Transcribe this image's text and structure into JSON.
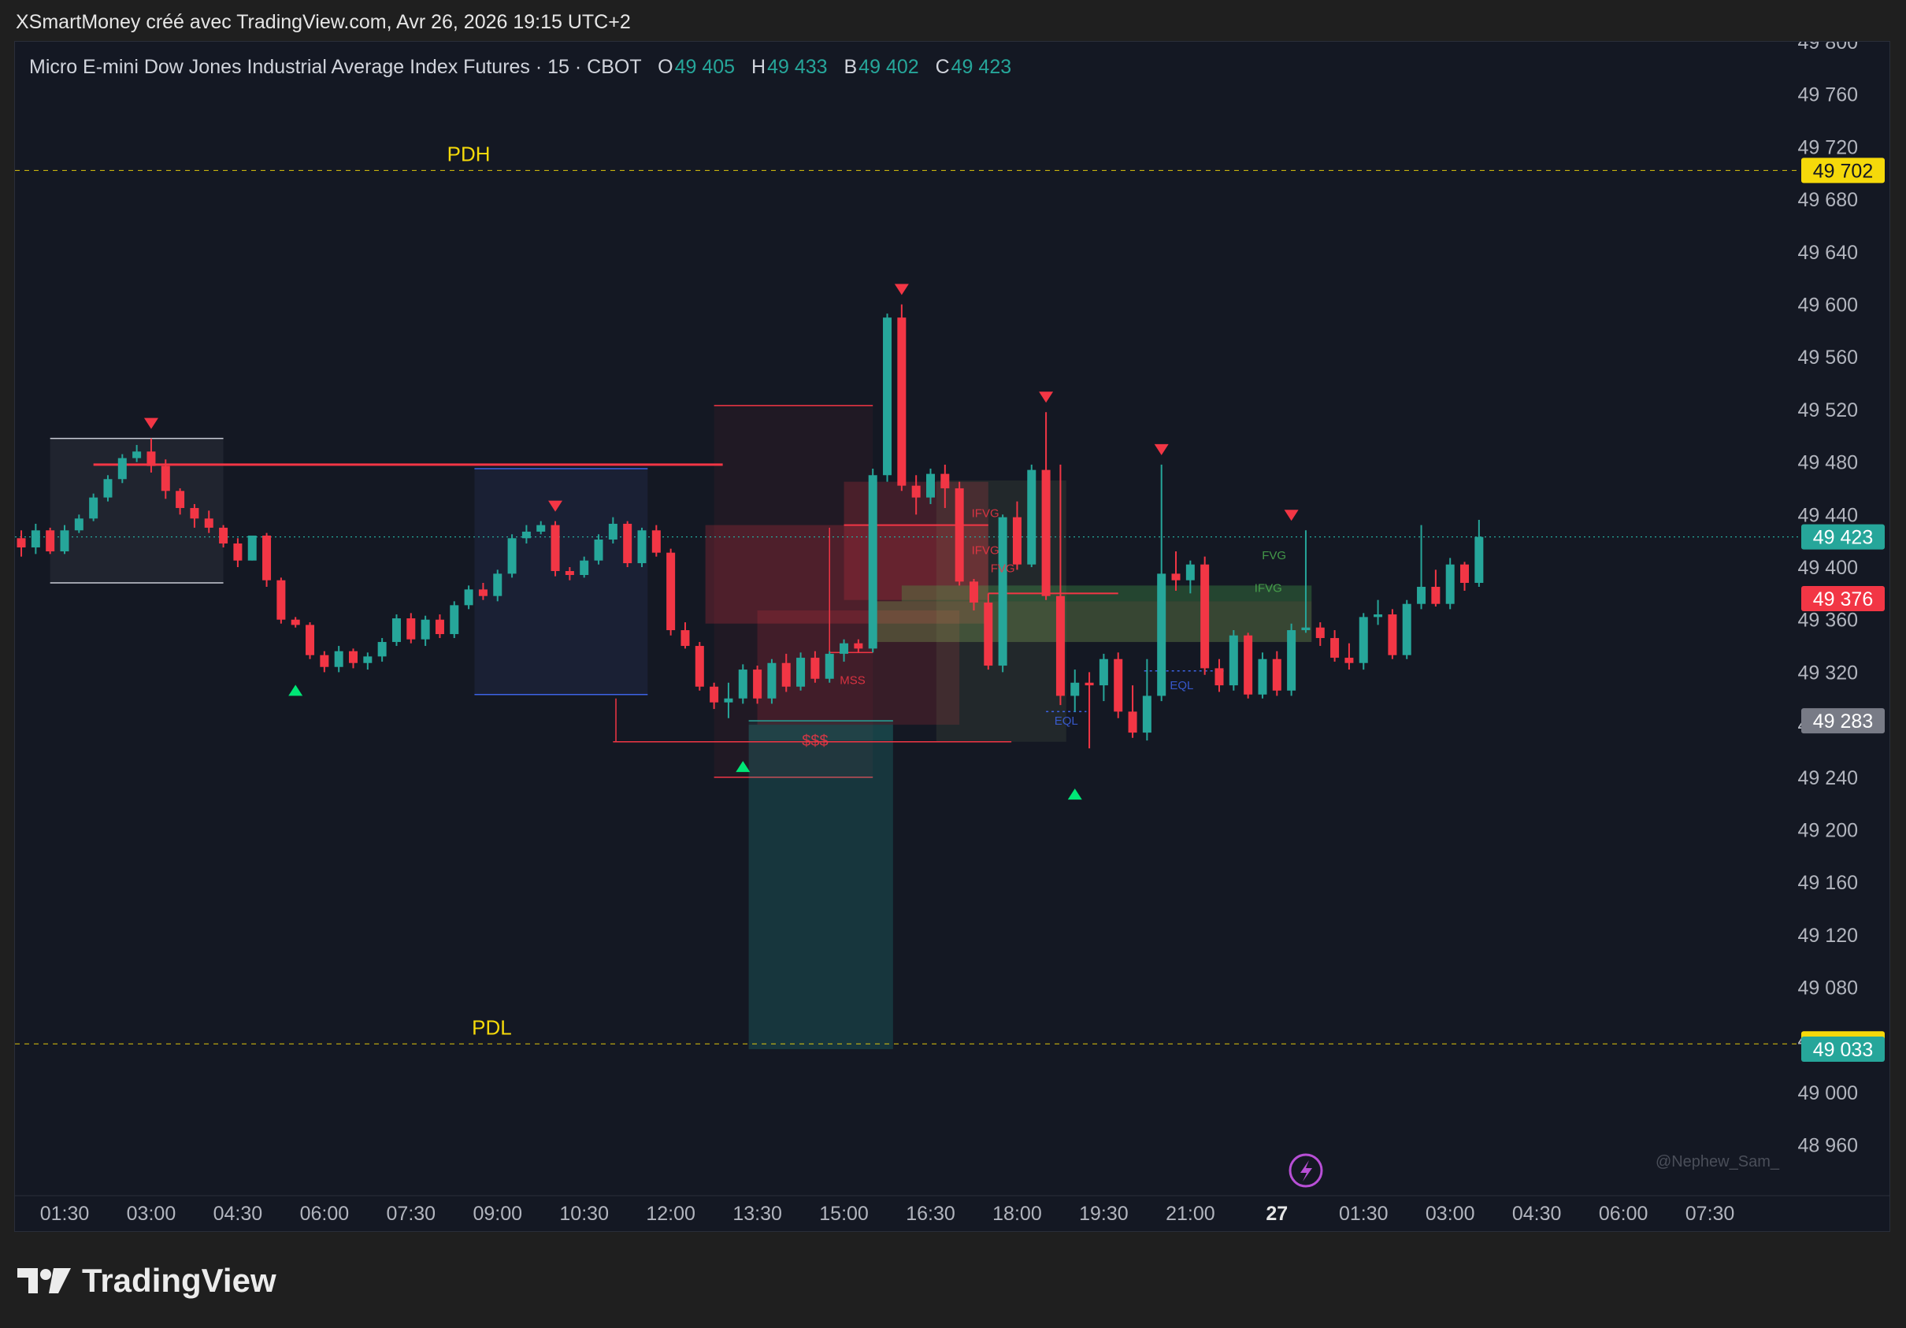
{
  "header": {
    "attribution": "XSmartMoney créé avec TradingView.com, Avr 26, 2026 19:15 UTC+2"
  },
  "legend": {
    "symbol": "Micro E-mini Dow Jones Industrial Average Index Futures · 15 · CBOT",
    "o_label": "O",
    "o_value": "49 405",
    "h_label": "H",
    "h_value": "49 433",
    "b_label": "B",
    "b_value": "49 402",
    "c_label": "C",
    "c_value": "49 423"
  },
  "brand": {
    "name": "TradingView"
  },
  "watermark": "@Nephew_Sam_",
  "colors": {
    "up": "#26a69a",
    "down": "#f23645",
    "pdh_pdl": "#f5d90a",
    "background": "#141823",
    "axis_text": "#b2b5be"
  },
  "chart_data": {
    "type": "candlestick",
    "y_range": [
      48940,
      49810
    ],
    "y_ticks": [
      "49 800",
      "49 760",
      "49 720",
      "49 680",
      "49 640",
      "49 600",
      "49 560",
      "49 520",
      "49 480",
      "49 440",
      "49 400",
      "49 360",
      "49 320",
      "49 280",
      "49 240",
      "49 200",
      "49 160",
      "49 120",
      "49 080",
      "49 040",
      "49 000",
      "48 960"
    ],
    "x_labels": [
      "01:30",
      "03:00",
      "04:30",
      "06:00",
      "07:30",
      "09:00",
      "10:30",
      "12:00",
      "13:30",
      "15:00",
      "16:30",
      "18:00",
      "19:30",
      "21:00",
      "27",
      "01:30",
      "03:00",
      "04:30",
      "06:00",
      "07:30"
    ],
    "price_labels": [
      {
        "value": 49702,
        "text": "49 702",
        "color": "#f5d90a",
        "text_color": "#131722"
      },
      {
        "value": 49423,
        "text": "49 423",
        "color": "#26a69a",
        "text_color": "#ffffff"
      },
      {
        "value": 49376,
        "text": "49 376",
        "color": "#f23645",
        "text_color": "#ffffff"
      },
      {
        "value": 49283,
        "text": "49 283",
        "color": "#787b86",
        "text_color": "#ffffff"
      },
      {
        "value": 49037,
        "text": "49 037",
        "color": "#f5d90a",
        "text_color": "#131722"
      },
      {
        "value": 49033,
        "text": "49 033",
        "color": "#26a69a",
        "text_color": "#ffffff"
      }
    ],
    "levels": [
      {
        "name": "PDH",
        "value": 49702,
        "label_time": 8.5
      },
      {
        "name": "PDL",
        "value": 49037,
        "label_time": 8.9
      }
    ],
    "current_price": 49423,
    "candles_start_time": 0.25,
    "candle_interval_hours": 0.25,
    "candles": [
      [
        49425,
        49430,
        49420,
        49412
      ],
      [
        49412,
        49425,
        49410,
        49422
      ],
      [
        49422,
        49428,
        49408,
        49415
      ],
      [
        49415,
        49433,
        49410,
        49428
      ],
      [
        49428,
        49430,
        49410,
        49412
      ],
      [
        49412,
        49432,
        49410,
        49428
      ],
      [
        49428,
        49440,
        49426,
        49437
      ],
      [
        49437,
        49456,
        49435,
        49453
      ],
      [
        49453,
        49470,
        49450,
        49467
      ],
      [
        49467,
        49486,
        49464,
        49483
      ],
      [
        49483,
        49493,
        49480,
        49488
      ],
      [
        49488,
        49498,
        49472,
        49477
      ],
      [
        49477,
        49482,
        49452,
        49458
      ],
      [
        49458,
        49460,
        49440,
        49445
      ],
      [
        49445,
        49448,
        49430,
        49437
      ],
      [
        49437,
        49443,
        49426,
        49430
      ],
      [
        49430,
        49432,
        49415,
        49418
      ],
      [
        49418,
        49422,
        49400,
        49405
      ],
      [
        49405,
        49408,
        49405,
        49424
      ],
      [
        49424,
        49426,
        49385,
        49390
      ],
      [
        49390,
        49392,
        49357,
        49360
      ],
      [
        49360,
        49362,
        49354,
        49356
      ],
      [
        49356,
        49358,
        49330,
        49333
      ],
      [
        49333,
        49336,
        49320,
        49324
      ],
      [
        49324,
        49340,
        49320,
        49336
      ],
      [
        49336,
        49338,
        49323,
        49327
      ],
      [
        49327,
        49335,
        49322,
        49332
      ],
      [
        49332,
        49346,
        49328,
        49343
      ],
      [
        49343,
        49364,
        49340,
        49361
      ],
      [
        49361,
        49365,
        49342,
        49345
      ],
      [
        49345,
        49363,
        49340,
        49360
      ],
      [
        49360,
        49364,
        49346,
        49349
      ],
      [
        49349,
        49374,
        49346,
        49371
      ],
      [
        49371,
        49386,
        49368,
        49383
      ],
      [
        49383,
        49388,
        49375,
        49378
      ],
      [
        49378,
        49398,
        49374,
        49395
      ],
      [
        49395,
        49425,
        49392,
        49422
      ],
      [
        49422,
        49432,
        49418,
        49427
      ],
      [
        49427,
        49435,
        49425,
        49432
      ],
      [
        49432,
        49435,
        49393,
        49397
      ],
      [
        49397,
        49400,
        49390,
        49394
      ],
      [
        49394,
        49408,
        49392,
        49405
      ],
      [
        49405,
        49425,
        49402,
        49421
      ],
      [
        49421,
        49438,
        49418,
        49433
      ],
      [
        49433,
        49435,
        49400,
        49403
      ],
      [
        49403,
        49430,
        49400,
        49428
      ],
      [
        49428,
        49432,
        49408,
        49411
      ],
      [
        49411,
        49414,
        49348,
        49352
      ],
      [
        49352,
        49358,
        49338,
        49340
      ],
      [
        49340,
        49343,
        49306,
        49309
      ],
      [
        49309,
        49312,
        49292,
        49297
      ],
      [
        49297,
        49312,
        49285,
        49300
      ],
      [
        49300,
        49326,
        49296,
        49322
      ],
      [
        49322,
        49325,
        49296,
        49300
      ],
      [
        49300,
        49330,
        49296,
        49327
      ],
      [
        49327,
        49334,
        49305,
        49309
      ],
      [
        49309,
        49335,
        49306,
        49331
      ],
      [
        49331,
        49336,
        49312,
        49315
      ],
      [
        49315,
        49336,
        49312,
        49334
      ],
      [
        49334,
        49345,
        49328,
        49342
      ],
      [
        49342,
        49345,
        49335,
        49338
      ],
      [
        49338,
        49475,
        49335,
        49470
      ],
      [
        49470,
        49593,
        49465,
        49590
      ],
      [
        49590,
        49600,
        49458,
        49462
      ],
      [
        49462,
        49470,
        49440,
        49453
      ],
      [
        49453,
        49475,
        49448,
        49471
      ],
      [
        49471,
        49478,
        49445,
        49460
      ],
      [
        49460,
        49465,
        49386,
        49389
      ],
      [
        49389,
        49391,
        49367,
        49373
      ],
      [
        49373,
        49380,
        49322,
        49325
      ],
      [
        49325,
        49440,
        49320,
        49438
      ],
      [
        49438,
        49450,
        49398,
        49402
      ],
      [
        49402,
        49478,
        49400,
        49474
      ],
      [
        49474,
        49518,
        49375,
        49378
      ],
      [
        49378,
        49478,
        49295,
        49302
      ],
      [
        49302,
        49322,
        49290,
        49312
      ],
      [
        49312,
        49320,
        49262,
        49310
      ],
      [
        49310,
        49334,
        49298,
        49330
      ],
      [
        49330,
        49335,
        49285,
        49290
      ],
      [
        49290,
        49310,
        49270,
        49274
      ],
      [
        49274,
        49330,
        49268,
        49302
      ],
      [
        49302,
        49478,
        49298,
        49395
      ],
      [
        49395,
        49412,
        49382,
        49390
      ],
      [
        49390,
        49405,
        49380,
        49402
      ],
      [
        49402,
        49408,
        49318,
        49323
      ],
      [
        49323,
        49330,
        49305,
        49310
      ],
      [
        49310,
        49352,
        49306,
        49348
      ],
      [
        49348,
        49350,
        49300,
        49303
      ],
      [
        49303,
        49335,
        49300,
        49330
      ],
      [
        49330,
        49336,
        49302,
        49306
      ],
      [
        49306,
        49357,
        49302,
        49352
      ],
      [
        49352,
        49428,
        49350,
        49354
      ],
      [
        49354,
        49358,
        49340,
        49346
      ],
      [
        49346,
        49352,
        49328,
        49331
      ],
      [
        49331,
        49342,
        49322,
        49327
      ],
      [
        49327,
        49365,
        49322,
        49362
      ],
      [
        49362,
        49375,
        49356,
        49364
      ],
      [
        49364,
        49368,
        49330,
        49333
      ],
      [
        49333,
        49375,
        49330,
        49372
      ],
      [
        49372,
        49432,
        49368,
        49385
      ],
      [
        49385,
        49398,
        49370,
        49372
      ],
      [
        49372,
        49407,
        49368,
        49402
      ],
      [
        49402,
        49404,
        49382,
        49388
      ],
      [
        49388,
        49436,
        49385,
        49423
      ]
    ],
    "swing_highs": [
      {
        "i": 11,
        "price": 49498
      },
      {
        "i": 39,
        "price": 49435
      },
      {
        "i": 63,
        "price": 49600
      },
      {
        "i": 73,
        "price": 49518
      },
      {
        "i": 81,
        "price": 49478
      },
      {
        "i": 90,
        "price": 49428
      }
    ],
    "swing_lows": [
      {
        "i": 21,
        "price": 49320
      },
      {
        "i": 52,
        "price": 49262
      },
      {
        "i": 75,
        "price": 49241
      }
    ],
    "zones": [
      {
        "t0": 1.25,
        "t1": 4.25,
        "p0": 49498,
        "p1": 49388,
        "fill": "rgba(180,184,196,0.08)",
        "stroke": "#c9ccd6",
        "edges": "tb"
      },
      {
        "t0": 8.6,
        "t1": 11.6,
        "p0": 49475,
        "p1": 49303,
        "fill": "rgba(70,90,180,0.12)",
        "stroke": "#3d63e6",
        "edges": "tb"
      },
      {
        "t0": 12.75,
        "t1": 15.5,
        "p0": 49523,
        "p1": 49240,
        "fill": "rgba(242,54,69,0.06)",
        "stroke": "#f23645",
        "edges": "tb"
      },
      {
        "t0": 12.6,
        "t1": 17.5,
        "p0": 49432,
        "p1": 49357,
        "fill": "rgba(242,54,69,0.22)",
        "stroke": "none",
        "edges": ""
      },
      {
        "t0": 13.5,
        "t1": 17.0,
        "p0": 49367,
        "p1": 49280,
        "fill": "rgba(242,54,69,0.16)",
        "stroke": "none",
        "edges": ""
      },
      {
        "t0": 15.0,
        "t1": 17.5,
        "p0": 49465,
        "p1": 49375,
        "fill": "rgba(242,54,69,0.20)",
        "stroke": "none",
        "edges": ""
      },
      {
        "t0": 16.6,
        "t1": 18.85,
        "p0": 49466,
        "p1": 49267,
        "fill": "rgba(120,140,90,0.14)",
        "stroke": "none",
        "edges": ""
      },
      {
        "t0": 15.5,
        "t1": 23.1,
        "p0": 49374,
        "p1": 49343,
        "fill": "rgba(140,180,90,0.30)",
        "stroke": "none",
        "edges": ""
      },
      {
        "t0": 16.0,
        "t1": 23.1,
        "p0": 49386,
        "p1": 49374,
        "fill": "rgba(76,175,80,0.30)",
        "stroke": "none",
        "edges": ""
      },
      {
        "t0": 13.35,
        "t1": 15.85,
        "p0": 49280,
        "p1": 49033,
        "fill": "rgba(38,166,154,0.22)",
        "stroke": "none",
        "edges": ""
      },
      {
        "t0": 13.35,
        "t1": 15.85,
        "p0": 49283,
        "p1": 49268,
        "fill": "rgba(38,166,154,0.10)",
        "stroke": "#26a69a",
        "edges": "t"
      }
    ],
    "lines": [
      {
        "t0": 2.0,
        "t1": 12.9,
        "p": 49478,
        "color": "#f23645",
        "width": 3
      },
      {
        "t0": 11.0,
        "t1": 17.9,
        "p": 49267,
        "color": "#f23645",
        "width": 1.5
      },
      {
        "t0": 14.75,
        "t1": 15.5,
        "p": 49335,
        "color": "#f23645",
        "width": 1.5
      },
      {
        "t0": 15.0,
        "t1": 17.5,
        "p": 49432,
        "color": "#f23645",
        "width": 2
      },
      {
        "t0": 17.5,
        "t1": 19.75,
        "p": 49380,
        "color": "#f23645",
        "width": 2
      },
      {
        "t0": 20.2,
        "t1": 21.6,
        "p": 49321,
        "color": "#3d63e6",
        "width": 1.5,
        "dash": "3,4"
      },
      {
        "t0": 18.5,
        "t1": 19.2,
        "p": 49290,
        "color": "#3d63e6",
        "width": 1.5,
        "dash": "3,4"
      }
    ],
    "vlines": [
      {
        "t": 14.75,
        "p0": 49335,
        "p1": 49430,
        "color": "#f23645"
      },
      {
        "t": 11.05,
        "p0": 49267,
        "p1": 49300,
        "color": "#f23645"
      }
    ],
    "annotations": [
      {
        "text": "$$$",
        "t": 14.5,
        "p": 49264,
        "color": "#f23645"
      },
      {
        "text": "MSS",
        "t": 15.15,
        "p": 49311,
        "color": "#f23645"
      },
      {
        "text": "IFVG",
        "t": 17.45,
        "p": 49438,
        "color": "#f23645"
      },
      {
        "text": "IFVG",
        "t": 17.45,
        "p": 49410,
        "color": "#f23645"
      },
      {
        "text": "FVG",
        "t": 17.75,
        "p": 49396,
        "color": "#f23645"
      },
      {
        "text": "FVG",
        "t": 22.45,
        "p": 49406,
        "color": "#4caf50"
      },
      {
        "text": "IFVG",
        "t": 22.35,
        "p": 49381,
        "color": "#4caf50"
      },
      {
        "text": "EQL",
        "t": 20.85,
        "p": 49307,
        "color": "#3d63e6"
      },
      {
        "text": "EQL",
        "t": 18.85,
        "p": 49280,
        "color": "#3d63e6"
      }
    ]
  }
}
